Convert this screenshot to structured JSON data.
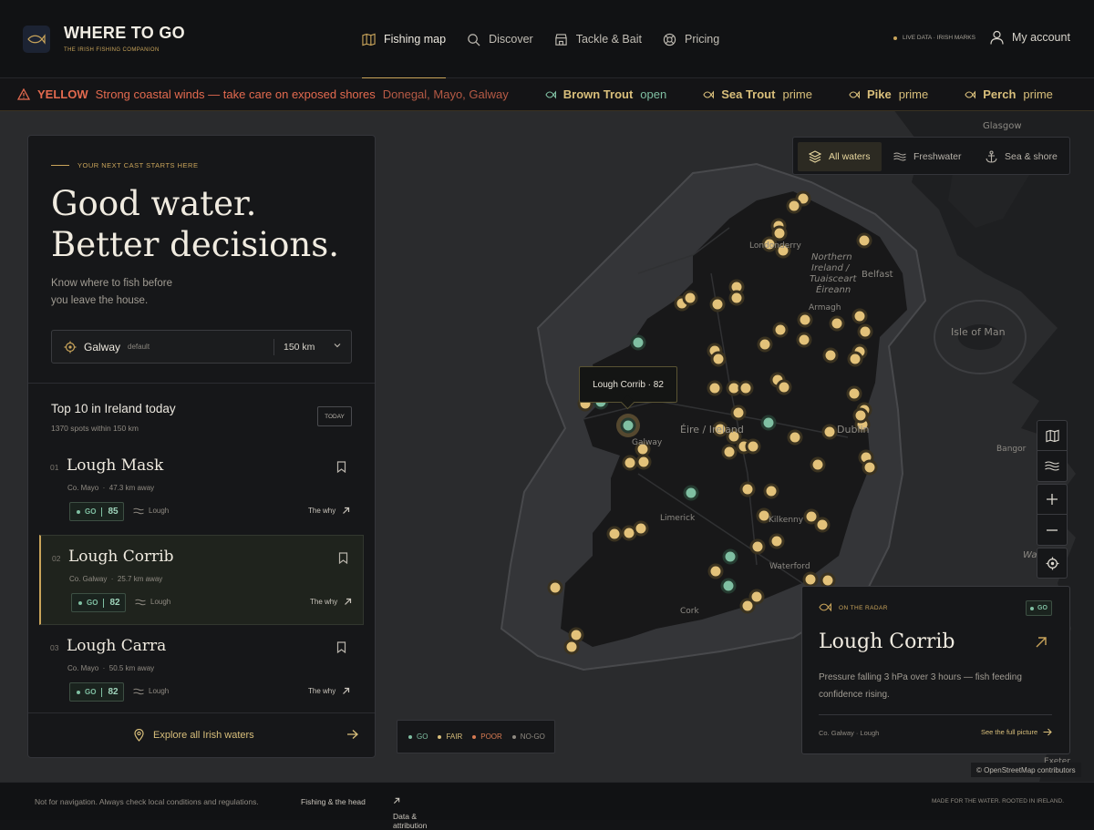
{
  "header": {
    "brand": "WHERE TO GO",
    "tagline": "THE IRISH FISHING COMPANION",
    "nav": [
      {
        "label": "Fishing map",
        "icon": "map-icon",
        "active": true
      },
      {
        "label": "Discover",
        "icon": "search-icon"
      },
      {
        "label": "Tackle & Bait",
        "icon": "shop-icon"
      },
      {
        "label": "Pricing",
        "icon": "lifebuoy-icon"
      }
    ],
    "live": "LIVE DATA · IRISH MARKS",
    "account": "My account"
  },
  "ticker": {
    "level": "YELLOW",
    "warning": "Strong coastal winds — take care on exposed shores",
    "areas": "Donegal, Mayo, Galway",
    "species": [
      {
        "name": "Brown Trout",
        "status": "open"
      },
      {
        "name": "Sea Trout",
        "status": "prime"
      },
      {
        "name": "Pike",
        "status": "prime"
      },
      {
        "name": "Perch",
        "status": "prime"
      }
    ]
  },
  "panel": {
    "kicker": "YOUR NEXT CAST STARTS HERE",
    "hero_line1": "Good water.",
    "hero_line2": "Better decisions.",
    "sub_line1": "Know where to fish before",
    "sub_line2": "you leave the house.",
    "location": {
      "city": "Galway",
      "tag": "default",
      "radius": "150 km"
    },
    "top_title": "Top 10 in Ireland today",
    "top_sub": "1370 spots within 150 km",
    "today": "TODAY",
    "items": [
      {
        "num": "01",
        "name": "Lough Mask",
        "county": "Co. Mayo",
        "distance": "47.3 km away",
        "status": "GO",
        "score": "85",
        "type": "Lough",
        "why": "The why"
      },
      {
        "num": "02",
        "name": "Lough Corrib",
        "county": "Co. Galway",
        "distance": "25.7 km away",
        "status": "GO",
        "score": "82",
        "type": "Lough",
        "why": "The why"
      },
      {
        "num": "03",
        "name": "Lough Carra",
        "county": "Co. Mayo",
        "distance": "50.5 km away",
        "status": "GO",
        "score": "82",
        "type": "Lough",
        "why": "The why"
      }
    ],
    "explore": "Explore all Irish waters"
  },
  "filters": [
    {
      "label": "All waters",
      "icon": "layers-icon",
      "active": true
    },
    {
      "label": "Freshwater",
      "icon": "waves-icon"
    },
    {
      "label": "Sea & shore",
      "icon": "anchor-icon"
    }
  ],
  "map": {
    "tooltip": "Lough Corrib · 82",
    "labels": {
      "glasgow": "Glasgow",
      "northern1": "Northern",
      "northern2": "Ireland /",
      "northern3": "Tuaisceart",
      "northern4": "Éireann",
      "belfast": "Belfast",
      "armagh": "Armagh",
      "iom": "Isle of Man",
      "eire": "Éire / Ireland",
      "dublin": "Dublin",
      "galway": "Galway",
      "limerick": "Limerick",
      "kilkenny": "Kilkenny",
      "waterford": "Waterford",
      "cork": "Cork",
      "bangor": "Bangor",
      "wales": "Wales",
      "exeter": "Exeter",
      "derry": "Londonderry"
    },
    "attribution": "© OpenStreetMap contributors"
  },
  "legend": [
    {
      "label": "GO",
      "color": "#7fbfa2"
    },
    {
      "label": "FAIR",
      "color": "#d9bf7b"
    },
    {
      "label": "POOR",
      "color": "#d77a52"
    },
    {
      "label": "NO-GO",
      "color": "#8f8a82"
    }
  ],
  "radar": {
    "kicker": "ON THE RADAR",
    "status": "GO",
    "title": "Lough Corrib",
    "desc": "Pressure falling 3 hPa over 3 hours — fish feeding confidence rising.",
    "location": "Co. Galway · Lough",
    "link": "See the full picture"
  },
  "footer": {
    "note": "Not for navigation. Always check local conditions and regulations.",
    "link1": "Fishing & the head",
    "link2": "Data & attribution",
    "made": "MADE FOR THE WATER. ROOTED IN IRELAND."
  },
  "colors": {
    "accent": "#c9a45a",
    "go": "#7fbfa2",
    "warning": "#e36a4f"
  }
}
